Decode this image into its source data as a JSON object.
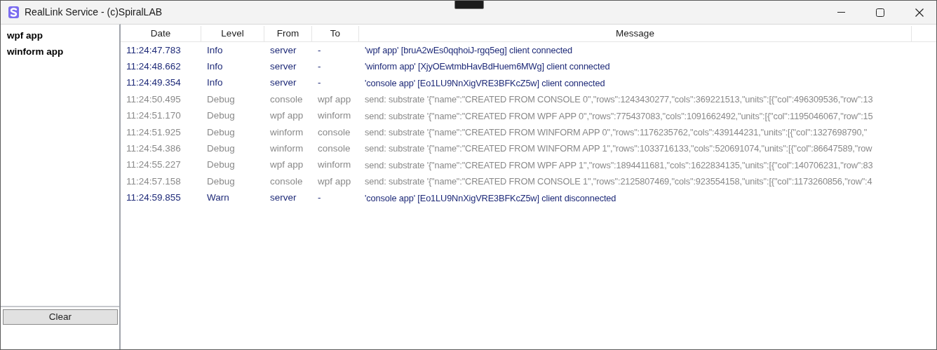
{
  "window": {
    "title": "RealLink Service - (c)SpiralLAB"
  },
  "clients": [
    {
      "name": "wpf app"
    },
    {
      "name": "winform app"
    }
  ],
  "clear_button": {
    "label": "Clear"
  },
  "table": {
    "columns": [
      "Date",
      "Level",
      "From",
      "To",
      "Message"
    ],
    "rows": [
      {
        "kind": "info",
        "date": "11:24:47.783",
        "level": "Info",
        "from": "server",
        "to": "-",
        "message": "'wpf app' [bruA2wEs0qqhoiJ-rgq5eg] client connected"
      },
      {
        "kind": "info",
        "date": "11:24:48.662",
        "level": "Info",
        "from": "server",
        "to": "-",
        "message": "'winform app' [XjyOEwtmbHavBdHuem6MWg] client connected"
      },
      {
        "kind": "info",
        "date": "11:24:49.354",
        "level": "Info",
        "from": "server",
        "to": "-",
        "message": "'console app' [Eo1LU9NnXigVRE3BFKcZ5w] client connected"
      },
      {
        "kind": "debug",
        "date": "11:24:50.495",
        "level": "Debug",
        "from": "console",
        "to": "wpf app",
        "message": "send: substrate '{\"name\":\"CREATED FROM CONSOLE 0\",\"rows\":1243430277,\"cols\":369221513,\"units\":[{\"col\":496309536,\"row\":13"
      },
      {
        "kind": "debug",
        "date": "11:24:51.170",
        "level": "Debug",
        "from": "wpf app",
        "to": "winform",
        "message": "send: substrate '{\"name\":\"CREATED FROM WPF APP 0\",\"rows\":775437083,\"cols\":1091662492,\"units\":[{\"col\":1195046067,\"row\":15"
      },
      {
        "kind": "debug",
        "date": "11:24:51.925",
        "level": "Debug",
        "from": "winform",
        "to": "console",
        "message": "send: substrate '{\"name\":\"CREATED FROM WINFORM APP 0\",\"rows\":1176235762,\"cols\":439144231,\"units\":[{\"col\":1327698790,\""
      },
      {
        "kind": "debug",
        "date": "11:24:54.386",
        "level": "Debug",
        "from": "winform",
        "to": "console",
        "message": "send: substrate '{\"name\":\"CREATED FROM WINFORM APP 1\",\"rows\":1033716133,\"cols\":520691074,\"units\":[{\"col\":86647589,\"row"
      },
      {
        "kind": "debug",
        "date": "11:24:55.227",
        "level": "Debug",
        "from": "wpf app",
        "to": "winform",
        "message": "send: substrate '{\"name\":\"CREATED FROM WPF APP 1\",\"rows\":1894411681,\"cols\":1622834135,\"units\":[{\"col\":140706231,\"row\":83"
      },
      {
        "kind": "debug",
        "date": "11:24:57.158",
        "level": "Debug",
        "from": "console",
        "to": "wpf app",
        "message": "send: substrate '{\"name\":\"CREATED FROM CONSOLE 1\",\"rows\":2125807469,\"cols\":923554158,\"units\":[{\"col\":1173260856,\"row\":4"
      },
      {
        "kind": "warn",
        "date": "11:24:59.855",
        "level": "Warn",
        "from": "server",
        "to": "-",
        "message": "'console app' [Eo1LU9NnXigVRE3BFKcZ5w] client disconnected"
      }
    ]
  }
}
